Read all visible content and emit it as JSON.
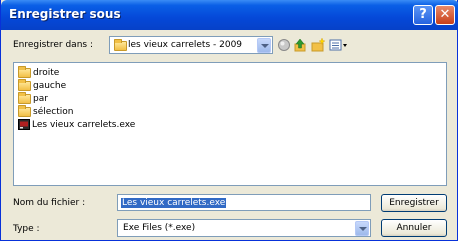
{
  "window": {
    "title": "Enregistrer sous",
    "help_glyph": "?",
    "close_glyph": "✕"
  },
  "save_in": {
    "label": "Enregistrer dans :",
    "value": "les vieux carrelets - 2009",
    "icon": "folder-icon"
  },
  "toolbar": {
    "icons": [
      "back-globe-icon",
      "up-folder-icon",
      "new-folder-icon",
      "view-menu-icon"
    ]
  },
  "files": [
    {
      "name": "droite",
      "kind": "folder"
    },
    {
      "name": "gauche",
      "kind": "folder"
    },
    {
      "name": "par",
      "kind": "folder"
    },
    {
      "name": "sélection",
      "kind": "folder"
    },
    {
      "name": "Les vieux carrelets.exe",
      "kind": "exe"
    }
  ],
  "filename": {
    "label": "Nom du fichier :",
    "value": "Les vieux carrelets.exe"
  },
  "filetype": {
    "label": "Type :",
    "value": "Exe Files (*.exe)"
  },
  "buttons": {
    "save": "Enregistrer",
    "cancel": "Annuler"
  },
  "colors": {
    "titlebar": "#0548d8",
    "selection": "#316ac5",
    "dialog_bg": "#ece9d8"
  }
}
